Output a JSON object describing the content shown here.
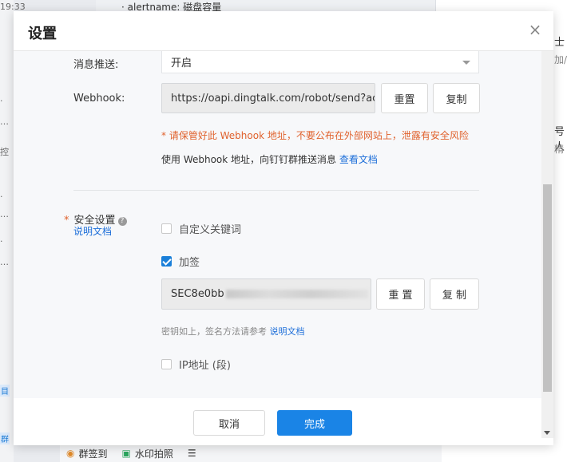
{
  "background": {
    "left_fragments": [
      "19:33",
      "·",
      "…",
      "·",
      "…",
      "控",
      "·",
      "…",
      "·",
      "…",
      "目",
      "群"
    ],
    "top_center": "· alertname: 磁盘容量",
    "right_fragments": [
      "士",
      "加/",
      "号人",
      "精"
    ],
    "bottom_bar": {
      "sign_in": "群签到",
      "watermark_photo": "水印拍照",
      "menu": "☰"
    }
  },
  "modal": {
    "title": "设置",
    "close_symbol": "×",
    "message_push": {
      "label": "消息推送:",
      "value": "开启"
    },
    "webhook": {
      "label": "Webhook:",
      "value": "https://oapi.dingtalk.com/robot/send?ac",
      "reset_label": "重置",
      "copy_label": "复制",
      "warning": "* 请保管好此 Webhook 地址，不要公布在外部网站上，泄露有安全风险",
      "note_prefix": "使用 Webhook 地址，向钉钉群推送消息",
      "note_link": "查看文档"
    },
    "security": {
      "required_mark": "*",
      "label": "安全设置",
      "help_icon": "?",
      "doc_link": "说明文档",
      "options": {
        "keyword": {
          "label": "自定义关键词",
          "checked": false
        },
        "signature": {
          "label": "加签",
          "checked": true
        },
        "ip": {
          "label": "IP地址 (段)",
          "checked": false
        }
      },
      "secret_value": "SEC8e0bb",
      "reset_label": "重 置",
      "copy_label": "复 制",
      "hint_prefix": "密钥如上，签名方法请参考",
      "hint_link": "说明文档"
    },
    "footer": {
      "cancel_label": "取消",
      "ok_label": "完成"
    }
  },
  "colors": {
    "primary": "#1a84e6",
    "warning": "#e0622d",
    "link": "#1e6fd9"
  }
}
